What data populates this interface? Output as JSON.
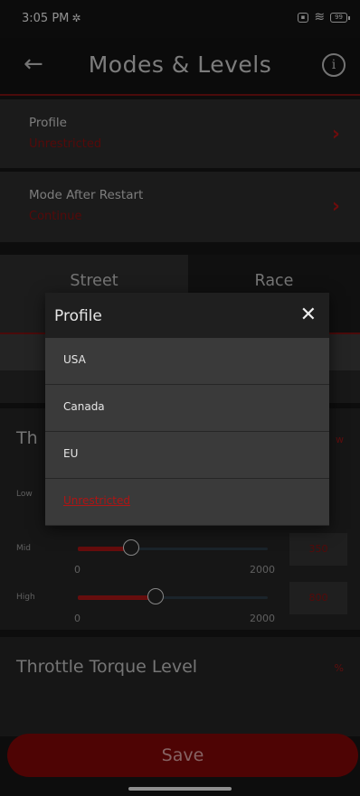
{
  "status_bar": {
    "time": "3:05 PM",
    "battery": "99"
  },
  "header": {
    "title": "Modes & Levels"
  },
  "settings": {
    "profile": {
      "label": "Profile",
      "value": "Unrestricted"
    },
    "mode_after_restart": {
      "label": "Mode After Restart",
      "value": "Continue"
    }
  },
  "tabs": [
    {
      "label": "Street"
    },
    {
      "label": "Race"
    }
  ],
  "throttle_speed": {
    "title": "Th",
    "unit": "w",
    "sliders": [
      {
        "label": "Low"
      },
      {
        "label": "Mid",
        "min": "0",
        "max": "2000",
        "value": "350",
        "level": 0.28
      },
      {
        "label": "High",
        "min": "0",
        "max": "2000",
        "value": "800",
        "level": 0.41
      }
    ]
  },
  "throttle_torque": {
    "title": "Throttle Torque Level",
    "unit": "%"
  },
  "save_button": {
    "label": "Save"
  },
  "profile_dialog": {
    "title": "Profile",
    "options": [
      "USA",
      "Canada",
      "EU",
      "Unrestricted"
    ],
    "selected": "Unrestricted"
  },
  "colors": {
    "accent": "#b01414",
    "background": "#151515",
    "save": "#7e0808"
  }
}
